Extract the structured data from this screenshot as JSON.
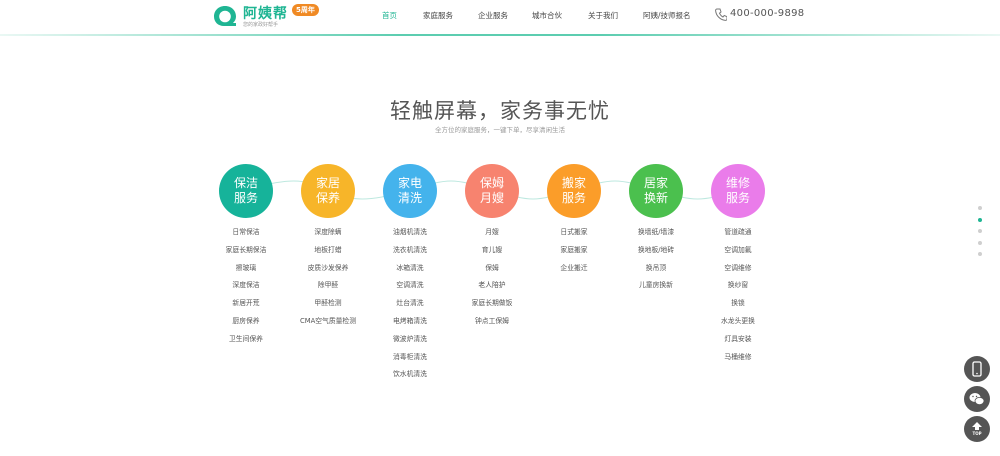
{
  "header": {
    "logo": {
      "name": "阿姨帮",
      "tagline": "您的家政好帮手",
      "badge": "5周年"
    },
    "nav": [
      {
        "label": "首页",
        "active": true
      },
      {
        "label": "家庭服务",
        "active": false
      },
      {
        "label": "企业服务",
        "active": false
      },
      {
        "label": "城市合伙",
        "active": false
      },
      {
        "label": "关于我们",
        "active": false
      },
      {
        "label": "阿姨/技师报名",
        "active": false
      }
    ],
    "phone": "400-000-9898",
    "icons": {
      "phone": "phone-icon"
    }
  },
  "hero": {
    "title": "轻触屏幕，家务事无忧",
    "subtitle": "全方位的家庭服务，一键下单，尽享清闲生活"
  },
  "services": [
    {
      "line1": "保洁",
      "line2": "服务",
      "color": "#16b39a",
      "items": [
        "日常保洁",
        "家庭长期保洁",
        "擦玻璃",
        "深度保洁",
        "新居开荒",
        "厨房保养",
        "卫生间保养"
      ]
    },
    {
      "line1": "家居",
      "line2": "保养",
      "color": "#f7b529",
      "items": [
        "深度除螨",
        "地板打蜡",
        "皮质沙发保养",
        "除甲醛",
        "甲醛检测",
        "CMA空气质量检测"
      ]
    },
    {
      "line1": "家电",
      "line2": "清洗",
      "color": "#44b3ec",
      "items": [
        "油烟机清洗",
        "洗衣机清洗",
        "冰箱清洗",
        "空调清洗",
        "灶台清洗",
        "电烤箱清洗",
        "微波炉清洗",
        "消毒柜清洗",
        "饮水机清洗"
      ]
    },
    {
      "line1": "保姆",
      "line2": "月嫂",
      "color": "#f7836f",
      "items": [
        "月嫂",
        "育儿嫂",
        "保姆",
        "老人陪护",
        "家庭长期做饭",
        "钟点工保姆"
      ]
    },
    {
      "line1": "搬家",
      "line2": "服务",
      "color": "#fb9d29",
      "items": [
        "日式搬家",
        "家庭搬家",
        "企业搬迁"
      ]
    },
    {
      "line1": "居家",
      "line2": "换新",
      "color": "#4bc04e",
      "items": [
        "换墙纸/墙漆",
        "换地板/地砖",
        "换吊顶",
        "儿童房换新"
      ]
    },
    {
      "line1": "维修",
      "line2": "服务",
      "color": "#ea7cea",
      "items": [
        "管道疏通",
        "空调加氟",
        "空调维修",
        "换纱窗",
        "换锁",
        "水龙头更换",
        "灯具安装",
        "马桶维修"
      ]
    }
  ],
  "side_dots": {
    "count": 5,
    "active_index": 1
  },
  "float_buttons": [
    {
      "icon": "mobile-icon"
    },
    {
      "icon": "wechat-icon"
    },
    {
      "icon": "arrow-up-icon",
      "label": "TOP"
    }
  ],
  "colors": {
    "accent": "#1fb593"
  }
}
